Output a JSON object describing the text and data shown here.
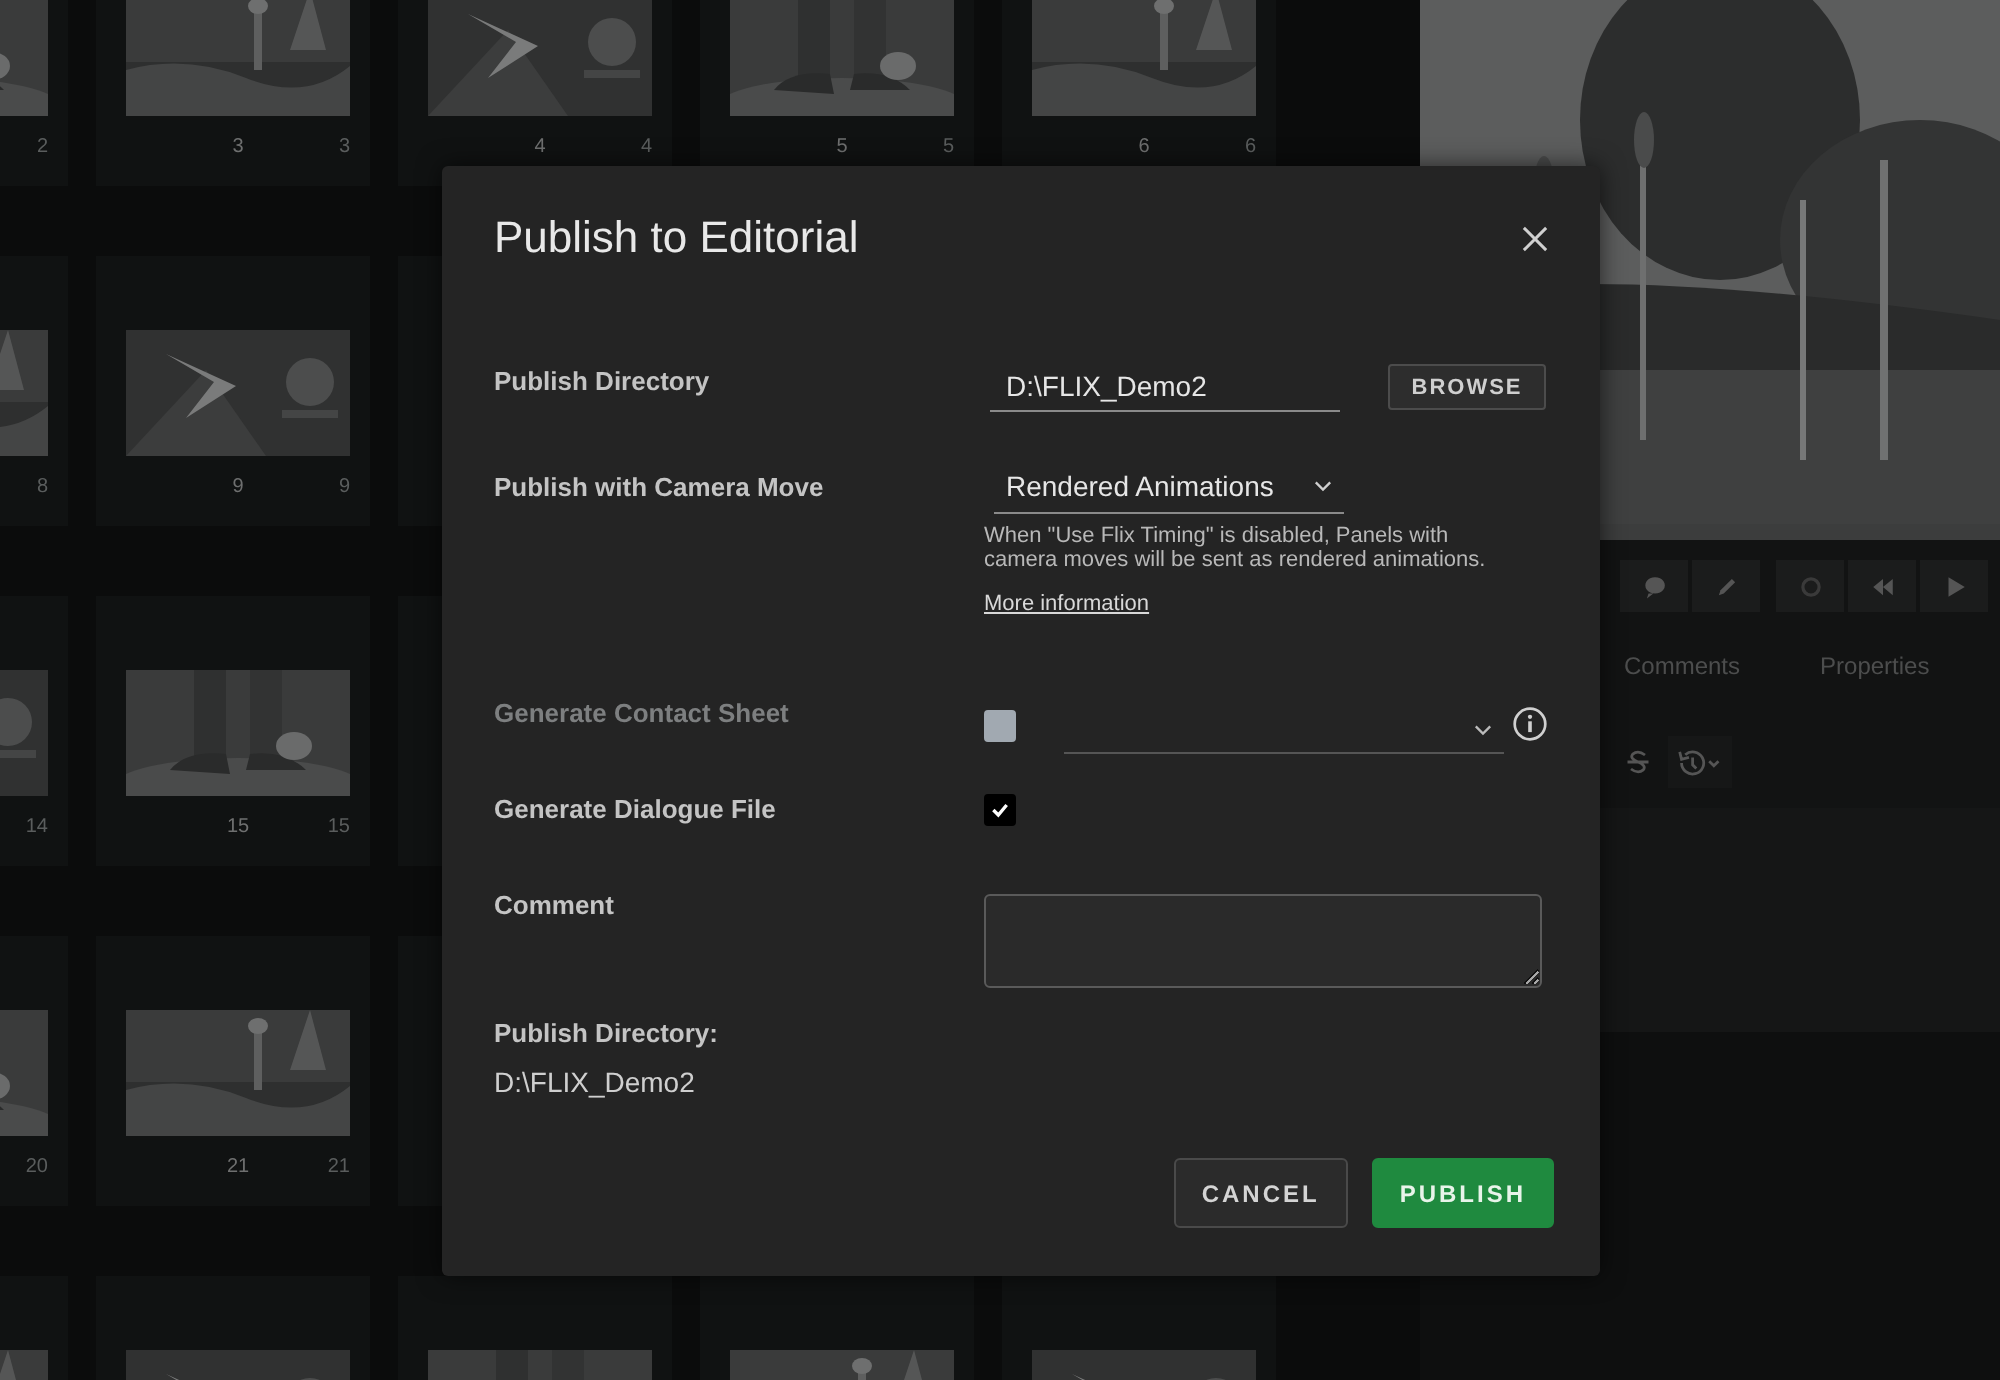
{
  "panels": {
    "rows": [
      {
        "cards": [
          {
            "kind": "picture",
            "corner": "2"
          },
          {
            "kind": "picture",
            "number": "3",
            "corner": "3"
          },
          {
            "kind": "picture",
            "number": "4",
            "corner": "4"
          },
          {
            "kind": "picture",
            "number": "5",
            "corner": "5"
          },
          {
            "kind": "picture",
            "number": "6",
            "corner": "6"
          }
        ]
      },
      {
        "cards": [
          {
            "kind": "picture",
            "corner": "8"
          },
          {
            "kind": "picture",
            "number": "9",
            "corner": "9"
          }
        ]
      },
      {
        "cards": [
          {
            "kind": "picture",
            "corner": "14"
          },
          {
            "kind": "picture",
            "number": "15",
            "corner": "15"
          }
        ]
      },
      {
        "cards": [
          {
            "kind": "picture",
            "corner": "20"
          },
          {
            "kind": "picture",
            "number": "21",
            "corner": "21"
          }
        ]
      },
      {
        "cards": [
          {
            "kind": "picture"
          },
          {
            "kind": "picture"
          },
          {
            "kind": "picture"
          },
          {
            "kind": "picture"
          },
          {
            "kind": "picture"
          }
        ]
      }
    ]
  },
  "side": {
    "tabs": [
      {
        "label": "Comments"
      },
      {
        "label": "Properties"
      }
    ]
  },
  "dialog": {
    "title": "Publish to Editorial",
    "fields": [
      {
        "kind": "path",
        "label": "Publish Directory",
        "value": "D:\\FLIX_Demo2",
        "button": "BROWSE"
      },
      {
        "kind": "select",
        "label": "Publish with Camera Move",
        "value": "Rendered Animations",
        "help": "When \"Use Flix Timing\" is disabled, Panels with camera moves will be sent as rendered animations.",
        "link": "More information"
      },
      {
        "kind": "checkbox-select",
        "label": "Generate Contact Sheet",
        "checked": false,
        "disabled": true
      },
      {
        "kind": "checkbox",
        "label": "Generate Dialogue File",
        "checked": true,
        "disabled": false
      },
      {
        "kind": "textarea",
        "label": "Comment"
      }
    ],
    "summary": {
      "label": "Publish Directory:",
      "value": "D:\\FLIX_Demo2"
    },
    "buttons": [
      {
        "label": "CANCEL",
        "primary": false
      },
      {
        "label": "PUBLISH",
        "primary": true
      }
    ]
  }
}
